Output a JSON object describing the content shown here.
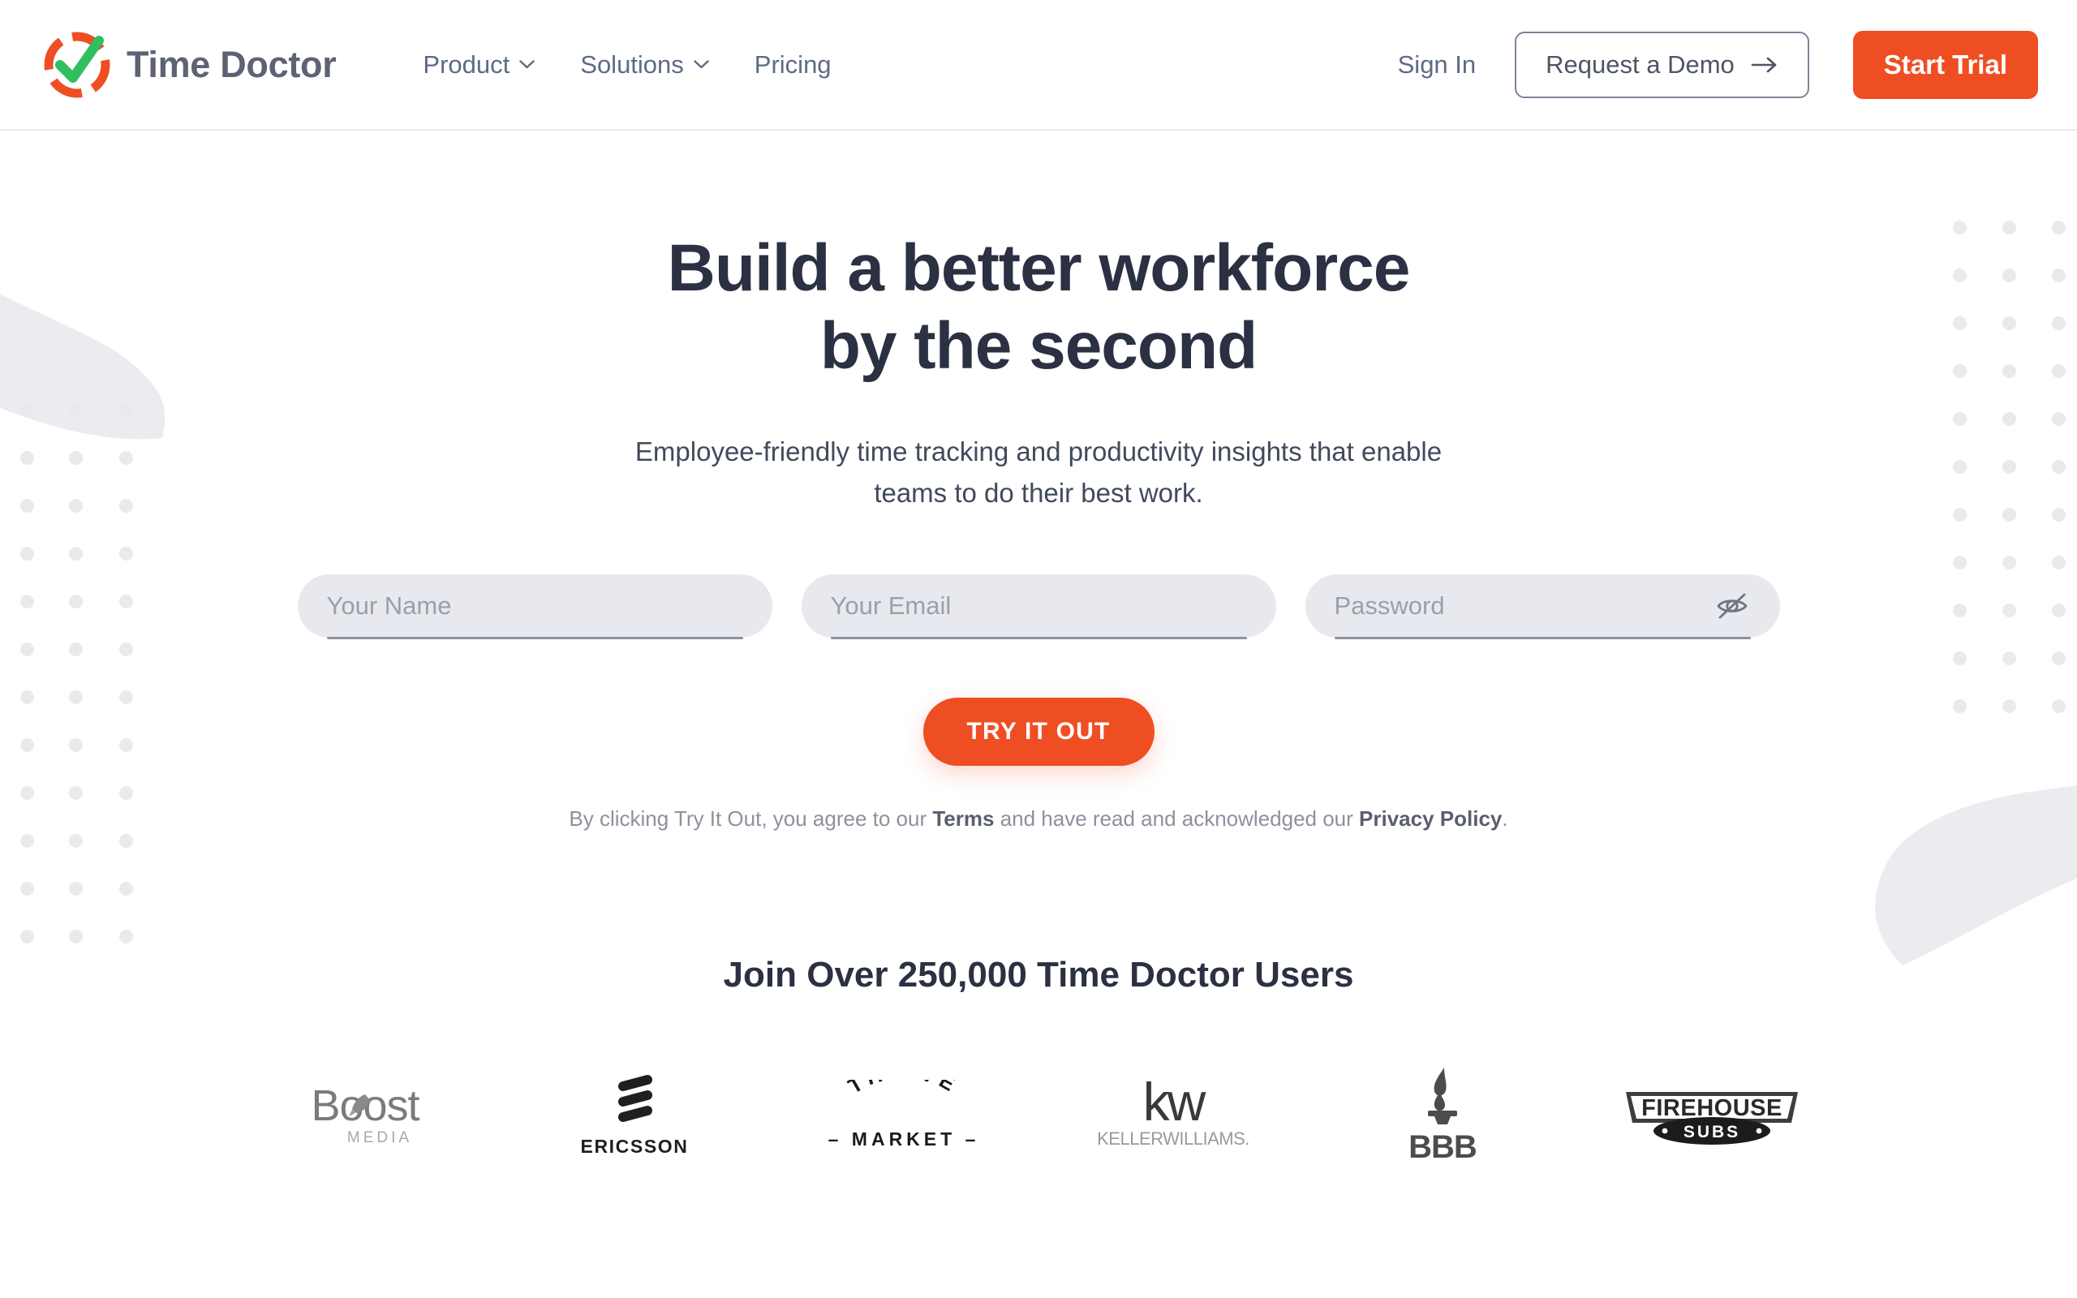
{
  "brand": {
    "name": "Time Doctor",
    "logo_icon": "time-doctor-clock-check-logo",
    "ring_color": "#ef4e23",
    "check_color": "#2fbf5f",
    "wordmark_color": "#5d6275"
  },
  "nav": {
    "items": [
      {
        "label": "Product",
        "has_dropdown": true,
        "icon": "chevron-down-icon"
      },
      {
        "label": "Solutions",
        "has_dropdown": true,
        "icon": "chevron-down-icon"
      },
      {
        "label": "Pricing",
        "has_dropdown": false,
        "icon": ""
      }
    ],
    "sign_in": "Sign In",
    "demo_button": "Request a Demo",
    "demo_icon": "arrow-right-icon",
    "trial_button": "Start Trial",
    "trial_color": "#ef4e23"
  },
  "hero": {
    "heading_line1": "Build a better workforce",
    "heading_line2": "by the second",
    "heading_color": "#2b3142",
    "subheading_line1": "Employee-friendly time tracking and productivity insights that enable",
    "subheading_line2": "teams to do their best work."
  },
  "signup_form": {
    "name_field": {
      "placeholder": "Your Name",
      "value": ""
    },
    "email_field": {
      "placeholder": "Your Email",
      "value": ""
    },
    "password_field": {
      "placeholder": "Password",
      "value": "",
      "toggle_icon": "eye-off-icon"
    },
    "submit_label": "TRY IT OUT",
    "submit_color": "#ef4e23",
    "terms_prefix": "By clicking Try It Out, you agree to our ",
    "terms_link": "Terms",
    "terms_middle": " and have read and acknowledged our ",
    "privacy_link": "Privacy Policy",
    "terms_suffix": "."
  },
  "social_proof": {
    "heading": "Join Over 250,000 Time Doctor Users",
    "logos": [
      {
        "name": "Boost Media",
        "word": "Boost",
        "sub": "MEDIA"
      },
      {
        "name": "Ericsson",
        "word": "ERICSSON",
        "sub": ""
      },
      {
        "name": "Thrive Market",
        "word": "THRIVE",
        "sub": "MARKET"
      },
      {
        "name": "Keller Williams",
        "word": "kw",
        "sub": "KELLERWILLIAMS."
      },
      {
        "name": "BBB",
        "word": "BBB",
        "sub": ""
      },
      {
        "name": "Firehouse Subs",
        "word": "FIREHOUSE",
        "sub": "SUBS"
      }
    ]
  },
  "decoration": {
    "dot_color": "#e9eaee",
    "blob_color": "#ebecef"
  }
}
